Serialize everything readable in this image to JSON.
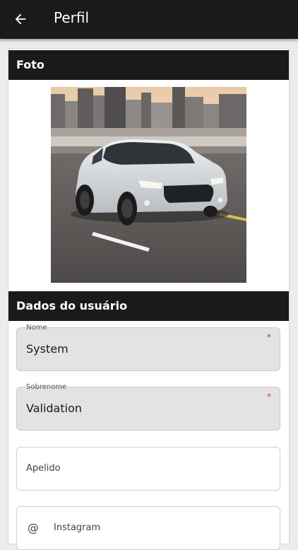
{
  "appbar": {
    "title": "Perfil",
    "back_icon": "arrow-left-icon"
  },
  "photo_section": {
    "title": "Foto",
    "image_description": "silver sedan driving on a city highway at dusk"
  },
  "user_section": {
    "title": "Dados do usuário",
    "fields": {
      "nome": {
        "label": "Nome",
        "value": "System",
        "required": "*"
      },
      "sobrenome": {
        "label": "Sobrenome",
        "value": "Validation",
        "required": "*"
      },
      "apelido": {
        "placeholder": "Apelido"
      },
      "instagram": {
        "placeholder": "Instagram",
        "icon": "at-icon",
        "prefix": "@"
      }
    }
  },
  "colors": {
    "appbar": "#1a1a1a",
    "section_header": "#1a1a1a",
    "filled_field": "#e3e3e3",
    "required": "#d33a3a"
  }
}
